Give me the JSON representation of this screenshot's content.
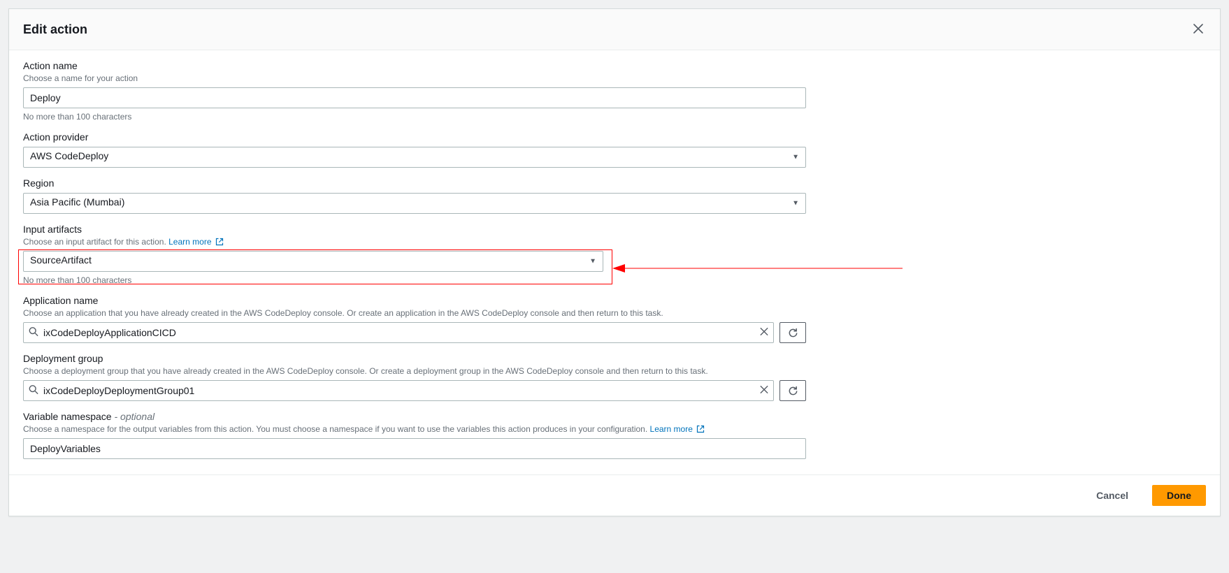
{
  "modal": {
    "title": "Edit action",
    "fields": {
      "action_name": {
        "label": "Action name",
        "hint": "Choose a name for your action",
        "value": "Deploy",
        "subhint": "No more than 100 characters"
      },
      "action_provider": {
        "label": "Action provider",
        "value": "AWS CodeDeploy"
      },
      "region": {
        "label": "Region",
        "value": "Asia Pacific (Mumbai)"
      },
      "input_artifacts": {
        "label": "Input artifacts",
        "hint": "Choose an input artifact for this action.",
        "learn_more": "Learn more",
        "value": "SourceArtifact",
        "subhint": "No more than 100 characters"
      },
      "application_name": {
        "label": "Application name",
        "hint": "Choose an application that you have already created in the AWS CodeDeploy console. Or create an application in the AWS CodeDeploy console and then return to this task.",
        "value": "ixCodeDeployApplicationCICD"
      },
      "deployment_group": {
        "label": "Deployment group",
        "hint": "Choose a deployment group that you have already created in the AWS CodeDeploy console. Or create a deployment group in the AWS CodeDeploy console and then return to this task.",
        "value": "ixCodeDeployDeploymentGroup01"
      },
      "variable_namespace": {
        "label": "Variable namespace",
        "optional_suffix": "- optional",
        "hint": "Choose a namespace for the output variables from this action. You must choose a namespace if you want to use the variables this action produces in your configuration.",
        "learn_more": "Learn more",
        "value": "DeployVariables"
      }
    },
    "buttons": {
      "cancel": "Cancel",
      "done": "Done"
    }
  }
}
